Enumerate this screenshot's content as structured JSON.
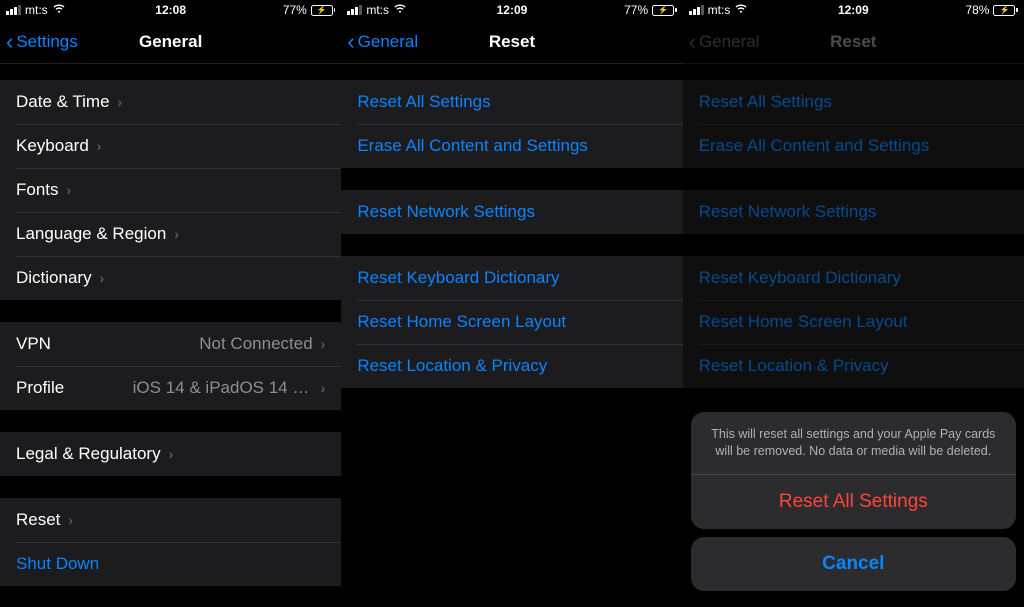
{
  "screens": [
    {
      "status": {
        "carrier": "mt:s",
        "time": "12:08",
        "battery_pct": "77%",
        "battery_fill": 77
      },
      "nav": {
        "back": "Settings",
        "title": "General"
      },
      "groups": [
        [
          {
            "label": "Date & Time"
          },
          {
            "label": "Keyboard"
          },
          {
            "label": "Fonts"
          },
          {
            "label": "Language & Region"
          },
          {
            "label": "Dictionary"
          }
        ],
        [
          {
            "label": "VPN",
            "value": "Not Connected"
          },
          {
            "label": "Profile",
            "value": "iOS 14 & iPadOS 14 Beta Softwar..."
          }
        ],
        [
          {
            "label": "Legal & Regulatory"
          }
        ],
        [
          {
            "label": "Reset"
          },
          {
            "label": "Shut Down",
            "blue": true,
            "nochev": true
          }
        ]
      ]
    },
    {
      "status": {
        "carrier": "mt:s",
        "time": "12:09",
        "battery_pct": "77%",
        "battery_fill": 77
      },
      "nav": {
        "back": "General",
        "title": "Reset"
      },
      "groups": [
        [
          {
            "label": "Reset All Settings",
            "blue": true,
            "nochev": true
          },
          {
            "label": "Erase All Content and Settings",
            "blue": true,
            "nochev": true
          }
        ],
        [
          {
            "label": "Reset Network Settings",
            "blue": true,
            "nochev": true
          }
        ],
        [
          {
            "label": "Reset Keyboard Dictionary",
            "blue": true,
            "nochev": true
          },
          {
            "label": "Reset Home Screen Layout",
            "blue": true,
            "nochev": true
          },
          {
            "label": "Reset Location & Privacy",
            "blue": true,
            "nochev": true
          }
        ]
      ]
    },
    {
      "status": {
        "carrier": "mt:s",
        "time": "12:09",
        "battery_pct": "78%",
        "battery_fill": 78
      },
      "nav": {
        "back": "General",
        "title": "Reset",
        "dim": true
      },
      "groups": [
        [
          {
            "label": "Reset All Settings",
            "blue": true,
            "nochev": true
          },
          {
            "label": "Erase All Content and Settings",
            "blue": true,
            "nochev": true
          }
        ],
        [
          {
            "label": "Reset Network Settings",
            "blue": true,
            "nochev": true
          }
        ],
        [
          {
            "label": "Reset Keyboard Dictionary",
            "blue": true,
            "nochev": true
          },
          {
            "label": "Reset Home Screen Layout",
            "blue": true,
            "nochev": true
          },
          {
            "label": "Reset Location & Privacy",
            "blue": true,
            "nochev": true
          }
        ]
      ],
      "sheet": {
        "message": "This will reset all settings and your Apple Pay cards will be removed. No data or media will be deleted.",
        "destructive": "Reset All Settings",
        "cancel": "Cancel"
      }
    }
  ]
}
